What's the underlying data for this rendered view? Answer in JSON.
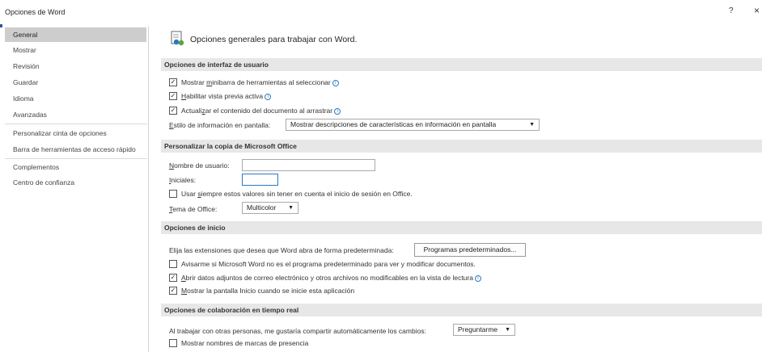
{
  "window": {
    "title": "Opciones de Word",
    "help": "?",
    "close": "×"
  },
  "sidebar": {
    "items": [
      {
        "label": "General"
      },
      {
        "label": "Mostrar"
      },
      {
        "label": "Revisión"
      },
      {
        "label": "Guardar"
      },
      {
        "label": "Idioma"
      },
      {
        "label": "Avanzadas"
      },
      {
        "label": "Personalizar cinta de opciones"
      },
      {
        "label": "Barra de herramientas de acceso rápido"
      },
      {
        "label": "Complementos"
      },
      {
        "label": "Centro de confianza"
      }
    ]
  },
  "header": {
    "title": "Opciones generales para trabajar con Word."
  },
  "ui_options": {
    "title": "Opciones de interfaz de usuario",
    "minibar": {
      "pre": "Mostrar ",
      "key": "m",
      "post": "inibarra de herramientas al seleccionar"
    },
    "live_preview": {
      "key": "H",
      "post": "abilitar vista previa activa"
    },
    "update_drag": {
      "pre": "Actuali",
      "key": "z",
      "post": "ar el contenido del documento al arrastrar"
    },
    "screentip": {
      "key": "E",
      "post": "stilo de información en pantalla:",
      "value": "Mostrar descripciones de características en información en pantalla"
    }
  },
  "personalize": {
    "title": "Personalizar la copia de Microsoft Office",
    "username": {
      "key": "N",
      "post": "ombre de usuario:",
      "value": ""
    },
    "initials": {
      "key": "I",
      "post": "niciales:",
      "value": ""
    },
    "always_use": {
      "pre": "Usar ",
      "key": "s",
      "post": "iempre estos valores sin tener en cuenta el inicio de sesión en Office."
    },
    "theme": {
      "key": "T",
      "post": "ema de Office:",
      "value": "Multicolor"
    }
  },
  "startup": {
    "title": "Opciones de inicio",
    "extensions_label": "Elija las extensiones que desea que Word abra de forma predeterminada:",
    "default_programs_button": "Programas predeterminados...",
    "notify_default": "Avisarme si Microsoft Word no es el programa predeterminado para ver y modificar documentos.",
    "open_attachments": {
      "key": "A",
      "post": "brir datos adjuntos de correo electrónico y otros archivos no modificables en la vista de lectura"
    },
    "show_start": {
      "key": "M",
      "post": "ostrar la pantalla Inicio cuando se inicie esta aplicación"
    }
  },
  "realtime": {
    "title": "Opciones de colaboración en tiempo real",
    "share_label": "Al trabajar con otras personas, me gustaría compartir automáticamente los cambios:",
    "share_value": "Preguntarme",
    "presence_flags": "Mostrar nombres de marcas de presencia"
  },
  "checkmarks": {
    "checked": "✓"
  },
  "colors": {
    "accent": "#2b579a",
    "selected_nav": "#cdcdcd",
    "section_bg": "#e7e7e7",
    "info": "#2b79c2"
  }
}
